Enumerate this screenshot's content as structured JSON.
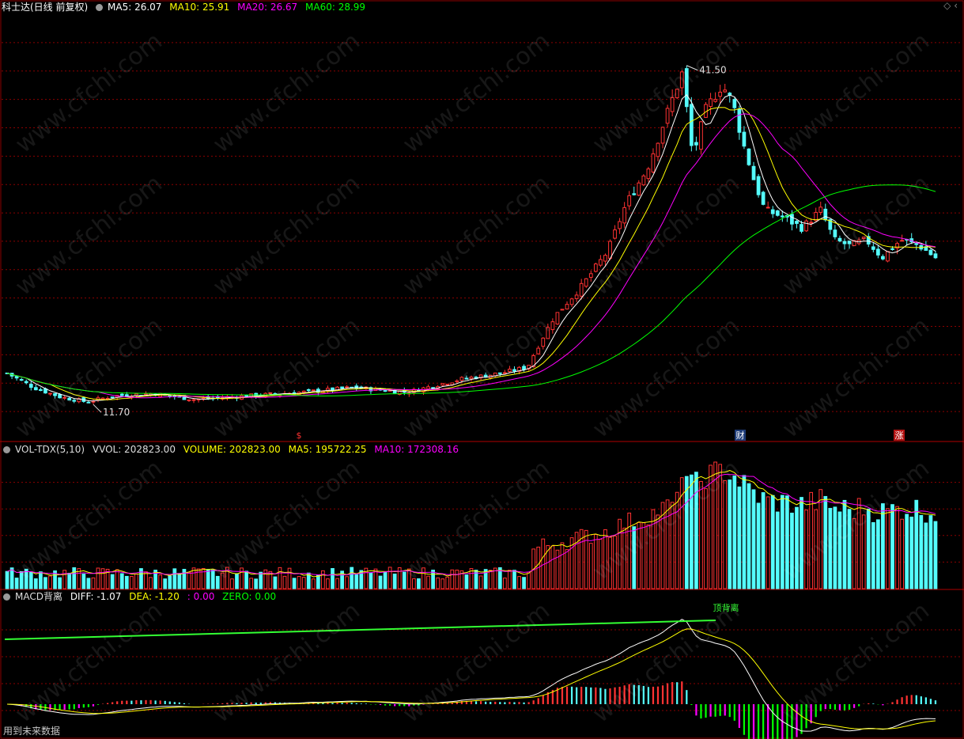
{
  "header": {
    "stock_title": "科士达(日线 前复权)",
    "ma5": "MA5: 26.07",
    "ma10": "MA10: 25.91",
    "ma20": "MA20: 26.67",
    "ma60": "MA60: 28.99"
  },
  "vol_header": {
    "name": "VOL-TDX(5,10)",
    "vvol": "VVOL: 202823.00",
    "volume": "VOLUME: 202823.00",
    "ma5": "MA5: 195722.25",
    "ma10": "MA10: 172308.16"
  },
  "macd_header": {
    "name": "MACD背离",
    "diff": "DIFF: -1.07",
    "dea": "DEA: -1.20",
    "third": ": 0.00",
    "zero": "ZERO: 0.00"
  },
  "markers": {
    "high_label": "41.50",
    "low_label": "11.70",
    "event_s": "$",
    "event_cai": "财",
    "event_zhang": "涨",
    "divergence": "顶背离"
  },
  "footer_note": "用到未来数据",
  "watermark": "www.cfchi.com",
  "colors": {
    "up": "#ff3232",
    "down": "#54fcfc",
    "ma5": "#ffffff",
    "ma10": "#ffff00",
    "ma20": "#ff00ff",
    "ma60": "#00ff00",
    "grid": "#8b0000",
    "macd_neg_a": "#00ff00",
    "macd_neg_b": "#ff00ff"
  },
  "chart_data": {
    "type": "candlestick",
    "price_ylim": [
      10,
      44
    ],
    "ohlc": [],
    "volume": [],
    "macd": []
  }
}
